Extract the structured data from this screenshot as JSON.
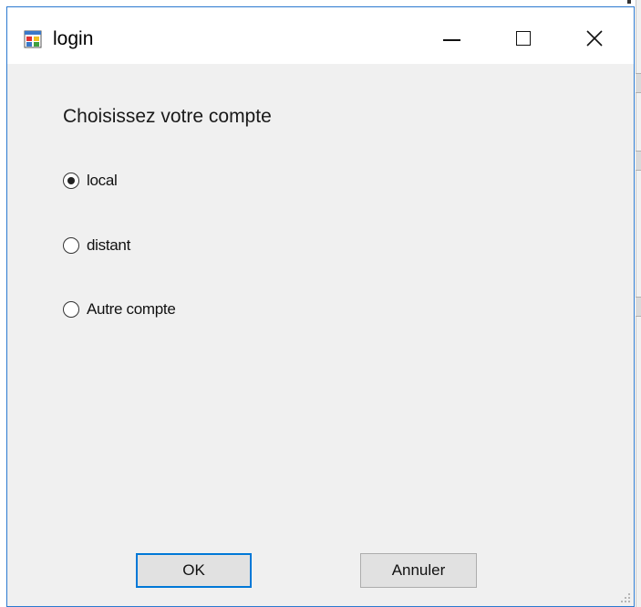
{
  "window": {
    "title": "login",
    "prompt": "Choisissez votre compte"
  },
  "titlebar": {
    "icon": "app-form-icon",
    "minimize_icon": "minimize-icon",
    "maximize_icon": "maximize-icon",
    "close_icon": "close-icon"
  },
  "options": [
    {
      "label": "local",
      "checked": true
    },
    {
      "label": "distant",
      "checked": false
    },
    {
      "label": "Autre compte",
      "checked": false
    }
  ],
  "buttons": {
    "ok_label": "OK",
    "cancel_label": "Annuler"
  },
  "colors": {
    "accent": "#0078d7",
    "window_bg": "#f0f0f0",
    "titlebar_bg": "#ffffff"
  }
}
